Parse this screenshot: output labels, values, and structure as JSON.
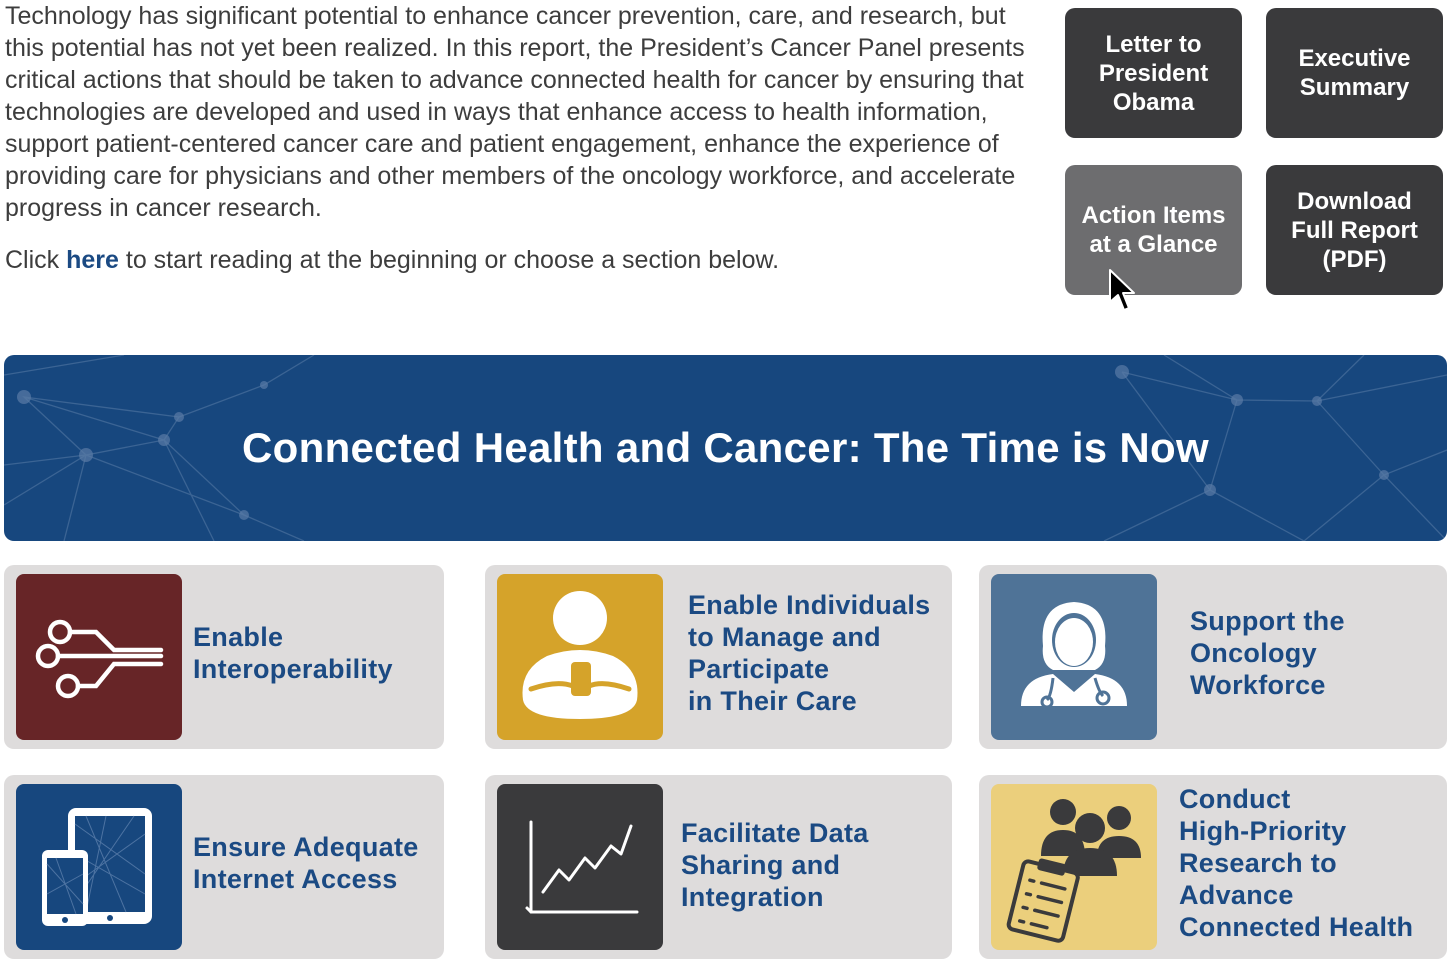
{
  "intro": {
    "paragraph": "Technology has significant potential to enhance cancer prevention, care, and research, but this potential has not yet been realized. In this report, the President’s Cancer Panel presents critical actions that should be taken to advance connected health for cancer by ensuring that technologies are developed and used in ways that enhance access to health information, support patient-centered cancer care and patient engagement, enhance the experience of providing care for physicians and other members of the oncology workforce, and accelerate progress in cancer research.",
    "click_prefix": "Click",
    "here_link": "here",
    "click_suffix": "to start reading at the beginning or choose a section below."
  },
  "nav_buttons": {
    "letter": "Letter to\nPresident\nObama",
    "executive": "Executive\nSummary",
    "action_items": "Action Items\nat a Glance",
    "download": "Download\nFull Report\n(PDF)"
  },
  "banner": {
    "title": "Connected Health and Cancer: The Time is Now"
  },
  "sections": {
    "interoperability": "Enable\nInteroperability",
    "individuals": "Enable Individuals\nto Manage and\nParticipate\nin Their Care",
    "workforce": "Support the\nOncology\nWorkforce",
    "internet": "Ensure Adequate\nInternet Access",
    "data_sharing": "Facilitate Data\nSharing and\nIntegration",
    "research": "Conduct\nHigh-Priority\nResearch to\nAdvance\nConnected Health"
  },
  "colors": {
    "banner": "#17477e",
    "button": "#3a3a3c",
    "button_hover": "#6d6d6f",
    "card": "#dedcdc",
    "label": "#1b4a83",
    "tile_interoperability": "#672527",
    "tile_individuals": "#d5a32a",
    "tile_workforce": "#4f7397",
    "tile_internet": "#17477e",
    "tile_data": "#3a3a3c",
    "tile_research": "#ebcf7c"
  },
  "icons": {
    "interoperability": "circuit-icon",
    "individuals": "person-phone-icon",
    "workforce": "doctor-icon",
    "internet": "devices-icon",
    "data_sharing": "line-chart-icon",
    "research": "team-clipboard-icon"
  }
}
